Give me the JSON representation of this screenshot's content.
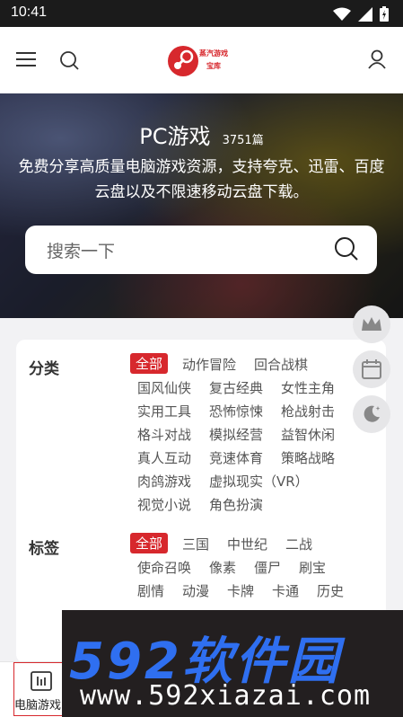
{
  "status": {
    "time": "10:41"
  },
  "header": {
    "logo_text_1": "蒸汽游戏",
    "logo_text_2": "宝库"
  },
  "hero": {
    "title": "PC游戏",
    "count": "3751篇",
    "desc": "免费分享高质量电脑游戏资源，支持夸克、迅雷、百度云盘以及不限速移动云盘下载。",
    "search_placeholder": "搜索一下"
  },
  "category": {
    "label": "分类",
    "items": [
      "全部",
      "动作冒险",
      "回合战棋",
      "国风仙侠",
      "复古经典",
      "女性主角",
      "实用工具",
      "恐怖惊悚",
      "枪战射击",
      "格斗对战",
      "模拟经营",
      "益智休闲",
      "真人互动",
      "竞速体育",
      "策略战略",
      "肉鸽游戏",
      "虚拟现实（VR）",
      "视觉小说",
      "角色扮演"
    ]
  },
  "tags": {
    "label": "标签",
    "items": [
      "全部",
      "三国",
      "中世纪",
      "二战",
      "使命召唤",
      "像素",
      "僵尸",
      "刷宝",
      "剧情",
      "动漫",
      "卡牌",
      "卡通",
      "历史"
    ]
  },
  "bottom_nav": {
    "label": "电脑游戏"
  },
  "watermark": {
    "logo": "592软件园",
    "url": "www.592xiazai.com"
  },
  "colors": {
    "accent": "#d7282d",
    "watermark_blue": "#2f6ff0"
  }
}
